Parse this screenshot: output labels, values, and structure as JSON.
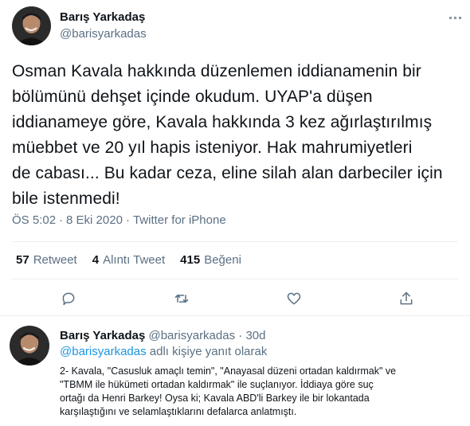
{
  "tweet": {
    "author_name": "Barış Yarkadaş",
    "author_handle": "@barisyarkadas",
    "text_lines": [
      "Osman Kavala hakkında düzenlemen iddianamenin bir",
      "bölümünü dehşet içinde okudum. UYAP'a düşen",
      "iddianameye göre, Kavala hakkında 3 kez ağırlaştırılmış",
      "müebbet ve 20 yıl hapis isteniyor. Hak mahrumiyetleri",
      "de cabası... Bu kadar ceza, eline silah alan darbeciler için",
      "bile istenmedi!"
    ],
    "time": "ÖS 5:02",
    "dot": "·",
    "date": "8 Eki 2020",
    "source": "Twitter for iPhone",
    "stats": {
      "retweets_count": "57",
      "retweets_label": "Retweet",
      "quotes_count": "4",
      "quotes_label": "Alıntı Tweet",
      "likes_count": "415",
      "likes_label": "Beğeni"
    }
  },
  "reply": {
    "author_name": "Barış Yarkadaş",
    "author_handle": "@barisyarkadas",
    "dot": "·",
    "age": "30d",
    "reply_to_handle": "@barisyarkadas",
    "reply_to_suffix": " adlı kişiye yanıt olarak",
    "text_lines": [
      "2- Kavala, \"Casusluk amaçlı temin\", \"Anayasal düzeni ortadan kaldırmak\" ve",
      "\"TBMM ile hükümeti ortadan kaldırmak\" ile suçlanıyor. İddiaya göre suç",
      "ortağı da Henri Barkey! Oysa ki; Kavala ABD'li Barkey ile bir lokantada",
      "karşılaştığını ve selamlaştıklarını defalarca anlatmıştı."
    ]
  },
  "icons": {
    "more": "more-dots-icon",
    "reply": "reply-bubble-icon",
    "retweet": "retweet-icon",
    "like": "heart-icon",
    "share": "share-icon"
  },
  "colors": {
    "text": "#0f1419",
    "secondary": "#5b7083",
    "link": "#1b95e0",
    "divider": "#ebeef0"
  }
}
